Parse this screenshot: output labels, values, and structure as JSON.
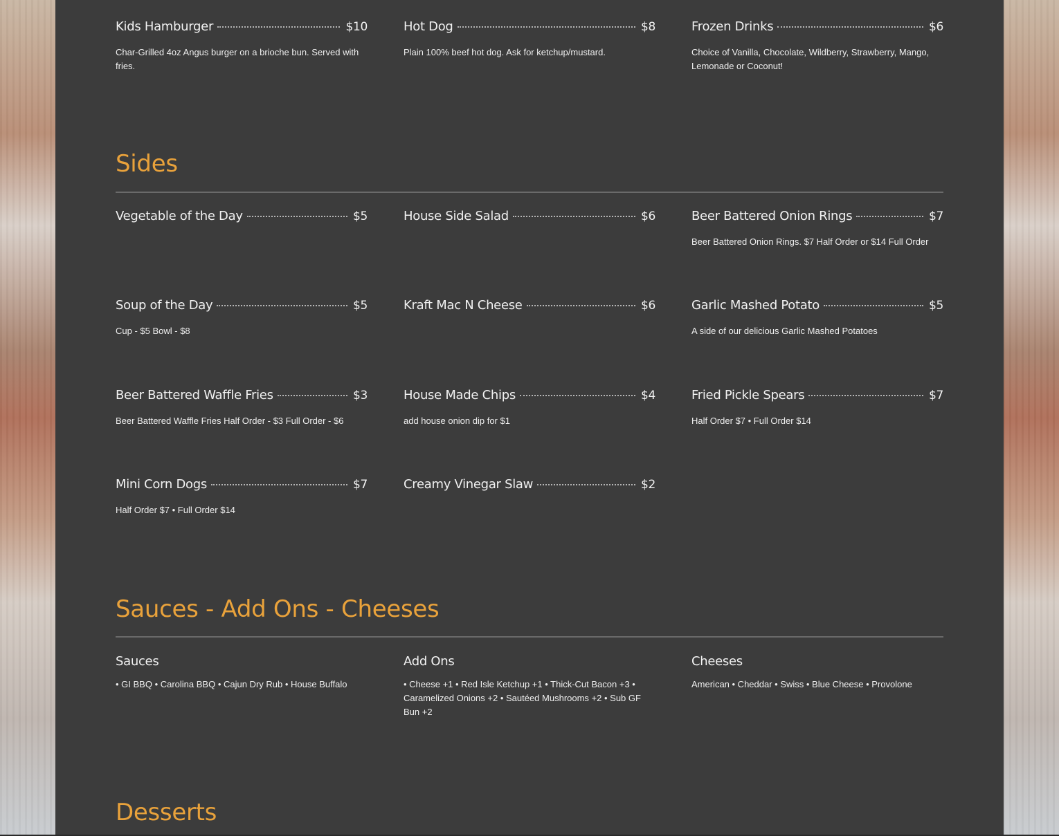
{
  "kids": [
    {
      "name": "Kids Hamburger",
      "price": "$10",
      "desc": "Char-Grilled 4oz Angus burger on a brioche bun. Served with fries."
    },
    {
      "name": "Hot Dog",
      "price": "$8",
      "desc": "Plain 100% beef hot dog. Ask for ketchup/mustard."
    },
    {
      "name": "Frozen Drinks",
      "price": "$6",
      "desc": "Choice of Vanilla, Chocolate, Wildberry, Strawberry, Mango, Lemonade or Coconut!"
    }
  ],
  "sides": {
    "title": "Sides",
    "items": [
      {
        "name": "Vegetable of the Day",
        "price": "$5",
        "desc": ""
      },
      {
        "name": "House Side Salad",
        "price": "$6",
        "desc": ""
      },
      {
        "name": "Beer Battered Onion Rings",
        "price": "$7",
        "desc": "Beer Battered Onion Rings. $7 Half Order or $14 Full Order"
      },
      {
        "name": "Soup of the Day",
        "price": "$5",
        "desc": "Cup - $5 Bowl - $8"
      },
      {
        "name": "Kraft Mac N Cheese",
        "price": "$6",
        "desc": ""
      },
      {
        "name": "Garlic Mashed Potato",
        "price": "$5",
        "desc": "A side of our delicious Garlic Mashed Potatoes"
      },
      {
        "name": "Beer Battered Waffle Fries",
        "price": "$3",
        "desc": "Beer Battered Waffle Fries Half Order - $3 Full Order - $6"
      },
      {
        "name": "House Made Chips",
        "price": "$4",
        "desc": "add house onion dip for $1"
      },
      {
        "name": "Fried Pickle Spears",
        "price": "$7",
        "desc": "Half Order $7 • Full Order $14"
      },
      {
        "name": "Mini Corn Dogs",
        "price": "$7",
        "desc": "Half Order $7 • Full Order $14"
      },
      {
        "name": "Creamy Vinegar Slaw",
        "price": "$2",
        "desc": ""
      }
    ]
  },
  "extras": {
    "title": "Sauces - Add Ons - Cheeses",
    "groups": [
      {
        "title": "Sauces",
        "text": "• GI BBQ • Carolina BBQ • Cajun Dry Rub • House Buffalo"
      },
      {
        "title": "Add Ons",
        "text": "• Cheese +1 • Red Isle Ketchup +1 • Thick-Cut Bacon +3 • Caramelized Onions +2 • Sautéed Mushrooms +2 • Sub GF Bun +2"
      },
      {
        "title": "Cheeses",
        "text": "American • Cheddar • Swiss • Blue Cheese • Provolone"
      }
    ]
  },
  "desserts": {
    "title": "Desserts"
  }
}
